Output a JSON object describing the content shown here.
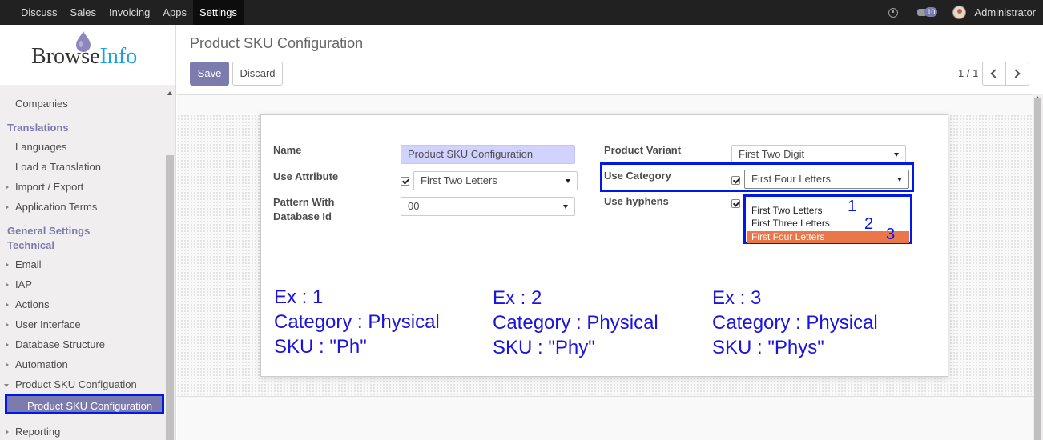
{
  "topbar": {
    "menu": [
      "Discuss",
      "Sales",
      "Invoicing",
      "Apps",
      "Settings"
    ],
    "active": "Settings",
    "chat_count": "10",
    "user": "Administrator"
  },
  "logo": {
    "browse": "Browse",
    "info": "Info"
  },
  "sidebar": {
    "items": [
      {
        "label": "Companies",
        "kind": "sub"
      },
      {
        "label": "Translations",
        "kind": "header"
      },
      {
        "label": "Languages",
        "kind": "sub"
      },
      {
        "label": "Load a Translation",
        "kind": "sub"
      },
      {
        "label": "Import / Export",
        "kind": "caret"
      },
      {
        "label": "Application Terms",
        "kind": "caret"
      },
      {
        "label": "General Settings",
        "kind": "header"
      },
      {
        "label": "Technical",
        "kind": "header"
      },
      {
        "label": "Email",
        "kind": "caret"
      },
      {
        "label": "IAP",
        "kind": "caret"
      },
      {
        "label": "Actions",
        "kind": "caret"
      },
      {
        "label": "User Interface",
        "kind": "caret"
      },
      {
        "label": "Database Structure",
        "kind": "caret"
      },
      {
        "label": "Automation",
        "kind": "caret"
      },
      {
        "label": "Product SKU Configuation",
        "kind": "caret-open"
      },
      {
        "label": "Product SKU Configuration",
        "kind": "selected"
      },
      {
        "label": "Reporting",
        "kind": "caret"
      }
    ]
  },
  "header": {
    "title": "Product SKU Configuration",
    "save_label": "Save",
    "discard_label": "Discard",
    "pager": "1 / 1"
  },
  "form": {
    "name_label": "Name",
    "name_value": "Product SKU Configuration",
    "use_attribute_label": "Use Attribute",
    "use_attribute_value": "First Two Letters",
    "pattern_label_1": "Pattern With",
    "pattern_label_2": "Database Id",
    "pattern_value": "00",
    "variant_label": "Product Variant",
    "variant_value": "First Two Digit",
    "use_category_label": "Use Category",
    "use_category_value": "First Four Letters",
    "hyphens_label": "Use hyphens"
  },
  "dropdown": {
    "options": [
      "First Two Letters",
      "First Three Letters",
      "First Four Letters"
    ],
    "selected": "First Four Letters",
    "numbers": [
      "1",
      "2",
      "3"
    ]
  },
  "examples": [
    {
      "title": "Ex : 1",
      "category": "Category : Physical",
      "sku": "SKU : \"Ph\""
    },
    {
      "title": "Ex : 2",
      "category": "Category : Physical",
      "sku": "SKU : \"Phy\""
    },
    {
      "title": "Ex : 3",
      "category": "Category : Physical",
      "sku": "SKU : \"Phys\""
    }
  ],
  "colors": {
    "accent": "#7c7bad",
    "highlight": "#0018e8",
    "annotation": "#1a14dc",
    "selected_option": "#e9774a"
  }
}
